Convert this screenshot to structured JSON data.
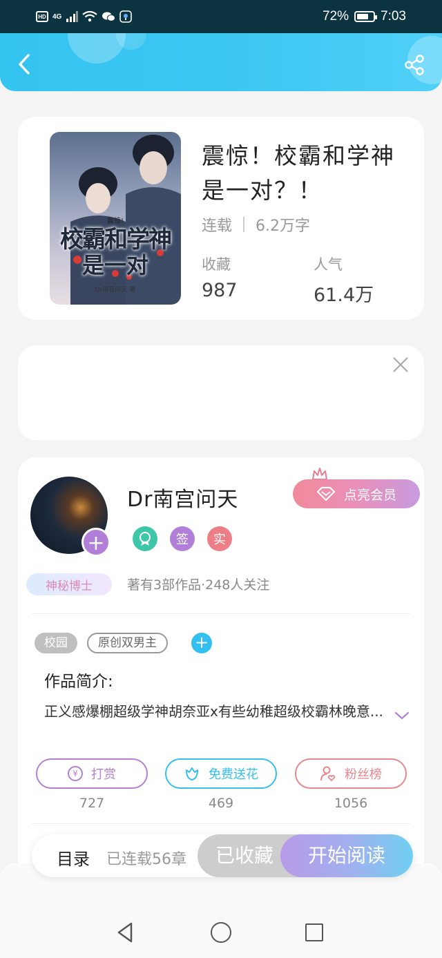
{
  "status_bar": {
    "network": "4G",
    "battery": "72%",
    "battery_level": 0.72,
    "time": "7:03"
  },
  "header": {
    "back_icon": "chevron-left-icon",
    "share_icon": "share-icon"
  },
  "book": {
    "title": "震惊！校霸和学神是一对？！",
    "status": "连载",
    "word_count": "6.2万字",
    "favorites_label": "收藏",
    "favorites_value": "987",
    "popularity_label": "人气",
    "popularity_value": "61.4万",
    "cover": {
      "small_text": "震惊!",
      "title_line1": "校霸和学神",
      "title_line2": "是一对",
      "author_text": "Dr南宫问天 著"
    }
  },
  "ad": {
    "close_icon": "close-icon"
  },
  "author": {
    "name": "Dr南宫问天",
    "vip_button": "点亮会员",
    "badge_sign": "签",
    "badge_real": "实",
    "title_tag": "神秘博士",
    "info": "著有3部作品·248人关注"
  },
  "tags": [
    "校园",
    "原创双男主"
  ],
  "intro": {
    "label": "作品简介:",
    "text": "正义感爆棚超级学神胡奈亚x有些幼稚超级校霸林晚意..."
  },
  "actions": [
    {
      "label": "打赏",
      "count": "727",
      "color": "#b27fd8"
    },
    {
      "label": "免费送花",
      "count": "469",
      "color": "#33bff0"
    },
    {
      "label": "粉丝榜",
      "count": "1056",
      "color": "#e8868c"
    }
  ],
  "read_bar": {
    "toc_label": "目录",
    "serial_label": "已连载56章",
    "fav_button": "已收藏",
    "start_button": "开始阅读"
  },
  "colors": {
    "header": "#3cc6f2",
    "accent_purple": "#b27fd8",
    "accent_blue": "#33bff0",
    "accent_pink": "#e8868c"
  }
}
